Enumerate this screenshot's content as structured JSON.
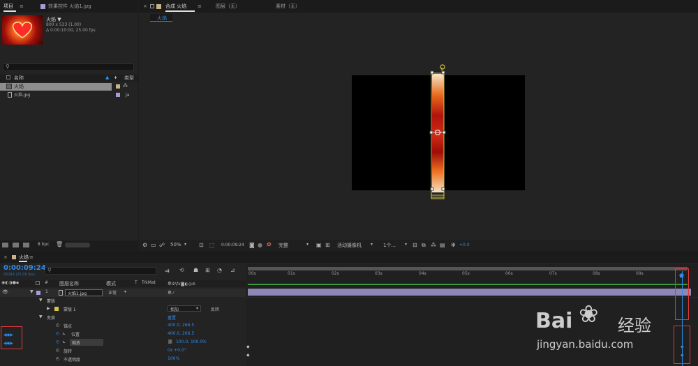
{
  "project_tabs": {
    "project": "项目",
    "effect_controls": "效果控件 火焰1.jpg"
  },
  "project_item": {
    "name": "火焰 ▼",
    "size": "800 x 533 (1.00)",
    "duration": "Δ 0:00:10:00, 25.00 fps"
  },
  "project_list": {
    "col_name": "名称",
    "col_type": "类型",
    "items": [
      {
        "name": "火焰",
        "type": ""
      },
      {
        "name": "火焰.jpg",
        "type": "Ja"
      }
    ],
    "bpc": "8 bpc"
  },
  "viewer_tabs": {
    "composition": "合成 火焰",
    "layer": "图层（无）",
    "footage": "素材（无）",
    "breadcrumb": "火焰"
  },
  "viewer_toolbar": {
    "zoom": "50%",
    "timecode": "0:00:09:24",
    "quality": "完整",
    "camera": "活动摄像机",
    "views": "1个...",
    "exposure": "+0.0"
  },
  "timeline": {
    "tab": "火焰",
    "timecode": "0:00:09:24",
    "timecode_sub": "00249 (25.00 fps)",
    "headers": {
      "source": "图层名称",
      "mode": "模式",
      "t": "T",
      "trkmat": "TrkMat"
    },
    "ruler": [
      "00s",
      "01s",
      "02s",
      "03s",
      "04s",
      "05s",
      "06s",
      "07s",
      "08s",
      "09s"
    ],
    "layer": {
      "index": "1",
      "name": "火焰1.jpg",
      "mode": "正常"
    },
    "groups": {
      "masks": "蒙版",
      "mask1": "蒙版 1",
      "mask_mode": "相加",
      "mask_invert": "反转",
      "transform": "变换",
      "reset": "重置"
    },
    "properties": [
      {
        "label": "锚点",
        "value": "400.0, 266.5"
      },
      {
        "label": "位置",
        "value": "400.0, 266.5"
      },
      {
        "label": "缩放",
        "value": "100.0, 100.0%"
      },
      {
        "label": "旋转",
        "value": "0x +0.0°"
      },
      {
        "label": "不透明度",
        "value": "100%"
      }
    ]
  },
  "watermark": {
    "brand": "Bai",
    "brand2": "经验",
    "url": "jingyan.baidu.com"
  }
}
